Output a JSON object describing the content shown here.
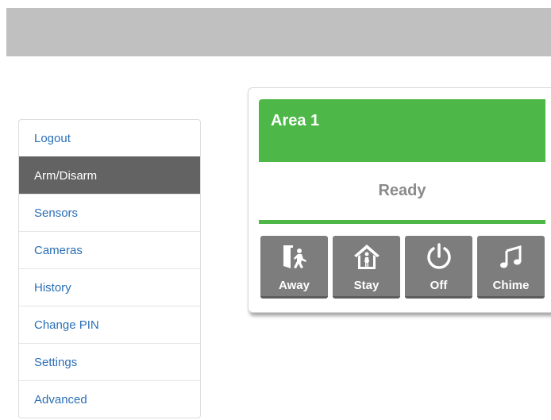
{
  "sidebar": {
    "items": [
      {
        "label": "Logout"
      },
      {
        "label": "Arm/Disarm"
      },
      {
        "label": "Sensors"
      },
      {
        "label": "Cameras"
      },
      {
        "label": "History"
      },
      {
        "label": "Change PIN"
      },
      {
        "label": "Settings"
      },
      {
        "label": "Advanced"
      }
    ]
  },
  "area": {
    "title": "Area 1",
    "status": "Ready"
  },
  "buttons": {
    "away": {
      "label": "Away",
      "icon": "door-walk-icon"
    },
    "stay": {
      "label": "Stay",
      "icon": "house-person-icon"
    },
    "off": {
      "label": "Off",
      "icon": "power-icon"
    },
    "chime": {
      "label": "Chime",
      "icon": "music-note-icon"
    }
  },
  "colors": {
    "ready_green": "#4db848",
    "active_nav": "#636363",
    "link_blue": "#2a6fb5",
    "button_gray": "#7d7d7d"
  }
}
